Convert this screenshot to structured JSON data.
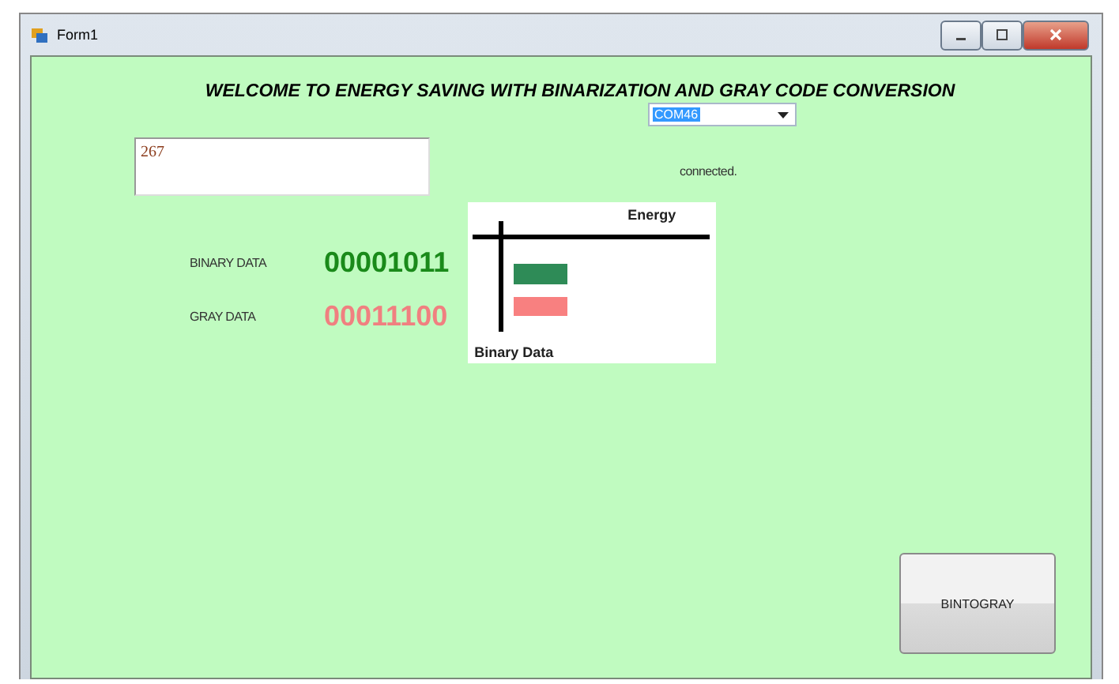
{
  "window": {
    "title": "Form1"
  },
  "heading": "WELCOME TO  ENERGY SAVING WITH BINARIZATION AND GRAY CODE CONVERSION",
  "port_combo": {
    "value": "COM46"
  },
  "input_box": {
    "value": "267"
  },
  "status": "connected.",
  "binary": {
    "label": "BINARY DATA",
    "value": "00001011"
  },
  "gray": {
    "label": "GRAY DATA",
    "value": "00011100"
  },
  "chart": {
    "title": "Energy",
    "axis_label": "Binary Data"
  },
  "button": "BINTOGRAY"
}
